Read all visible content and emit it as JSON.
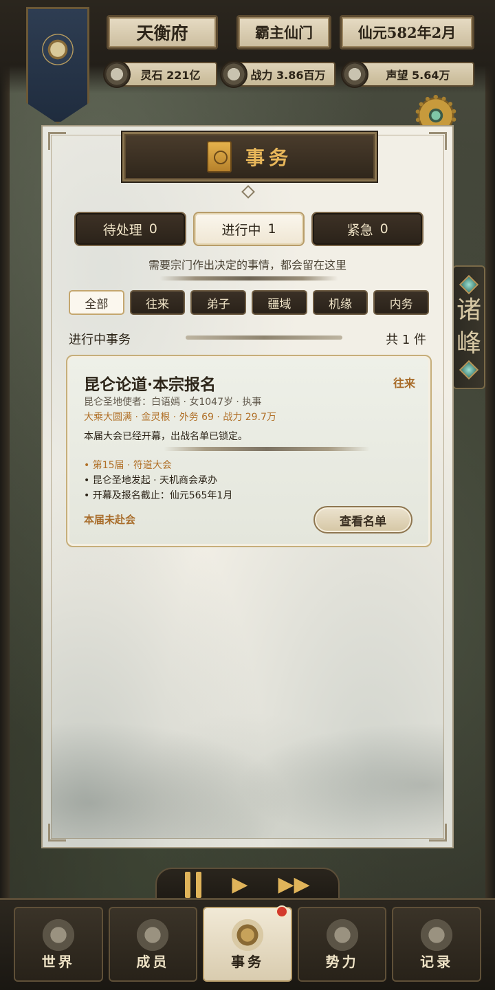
{
  "hud": {
    "sect_name": "天衡府",
    "rank": "霸主仙门",
    "date": "仙元582年2月",
    "stats": [
      {
        "icon": "spirit-stone-icon",
        "text": "灵石 221亿"
      },
      {
        "icon": "sword-icon",
        "text": "战力 3.86百万"
      },
      {
        "icon": "reputation-icon",
        "text": "声望 5.64万"
      }
    ]
  },
  "side_tab": {
    "label_1": "诸",
    "label_2": "峰"
  },
  "panel": {
    "title": "事务",
    "tabs": [
      {
        "label": "待处理",
        "count": "0"
      },
      {
        "label": "进行中",
        "count": "1"
      },
      {
        "label": "紧急",
        "count": "0"
      }
    ],
    "hint": "需要宗门作出决定的事情，都会留在这里",
    "filters": [
      "全部",
      "往来",
      "弟子",
      "疆域",
      "机缘",
      "内务"
    ],
    "section_title": "进行中事务",
    "section_count": "共 1 件",
    "card": {
      "title": "昆仑论道·本宗报名",
      "tag": "往来",
      "meta": "昆仑圣地使者：白语嫣 · 女1047岁 · 执事",
      "attributes": "大乘大圆满 · 金灵根 · 外务 69 · 战力 29.7万",
      "description": "本届大会已经开幕，出战名单已锁定。",
      "details": [
        "• 第15届 · 符道大会",
        "• 昆仑圣地发起 · 天机商会承办",
        "• 开幕及报名截止：仙元565年1月"
      ],
      "status": "本届未赴会",
      "button": "查看名单"
    }
  },
  "playback": {
    "pause": "pause-icon",
    "play": "▶",
    "fast": "▶▶"
  },
  "nav": [
    {
      "label": "世界",
      "icon": "world-icon"
    },
    {
      "label": "成员",
      "icon": "member-icon"
    },
    {
      "label": "事务",
      "icon": "scroll-icon"
    },
    {
      "label": "势力",
      "icon": "banner-icon"
    },
    {
      "label": "记录",
      "icon": "book-icon"
    }
  ],
  "colors": {
    "accent": "#e8b75a",
    "tag": "#a86c2a",
    "notification": "#d33a2c"
  }
}
